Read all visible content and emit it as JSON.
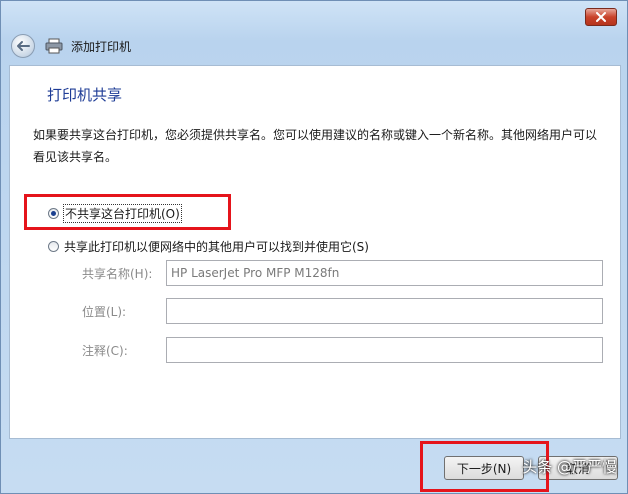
{
  "window": {
    "title": "添加打印机"
  },
  "page": {
    "heading": "打印机共享",
    "description": "如果要共享这台打印机，您必须提供共享名。您可以使用建议的名称或键入一个新名称。其他网络用户可以看见该共享名。"
  },
  "options": {
    "no_share": {
      "label": "不共享这台打印机(O)",
      "selected": true
    },
    "share": {
      "label": "共享此打印机以便网络中的其他用户可以找到并使用它(S)",
      "selected": false
    }
  },
  "fields": {
    "share_name": {
      "label": "共享名称(H):",
      "value": "HP LaserJet Pro MFP M128fn"
    },
    "location": {
      "label": "位置(L):",
      "value": ""
    },
    "comment": {
      "label": "注释(C):",
      "value": ""
    }
  },
  "buttons": {
    "next": "下一步(N)",
    "cancel": "取消"
  },
  "watermark": "头条 @严严慢",
  "colors": {
    "highlight": "#e5141b",
    "heading": "#1e3c96"
  }
}
